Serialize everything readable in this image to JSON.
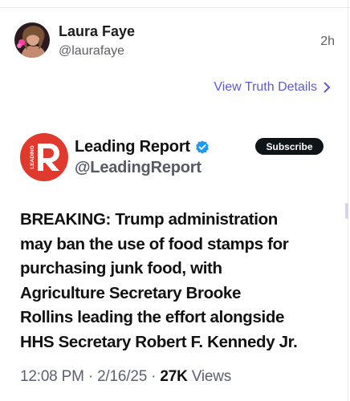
{
  "post": {
    "author_name": "Laura Faye",
    "author_handle": "@laurafaye",
    "time": "2h",
    "details_link": "View Truth Details"
  },
  "embed": {
    "name": "Leading Report",
    "handle": "@LeadingReport",
    "logo_text": "LEADING",
    "subscribe_label": "Subscribe",
    "body_lines": [
      "BREAKING: Trump administration",
      "may ban the use of food stamps for",
      "purchasing junk food, with",
      "Agriculture Secretary Brooke",
      "Rollins leading the effort alongside",
      "HHS Secretary Robert F. Kennedy Jr."
    ],
    "time": "12:08 PM",
    "date": "2/16/25",
    "views_count": "27K",
    "views_label": "Views",
    "separator": "·"
  },
  "colors": {
    "accent": "#5b5bd6",
    "logo_red": "#e03a2f",
    "verified_blue": "#1d9bf0",
    "subscribe_bg": "#0f1419"
  },
  "icons": {
    "chevron": "chevron-right-icon",
    "verified": "verified-badge-icon",
    "avatar": "avatar",
    "logo": "leading-report-logo"
  }
}
